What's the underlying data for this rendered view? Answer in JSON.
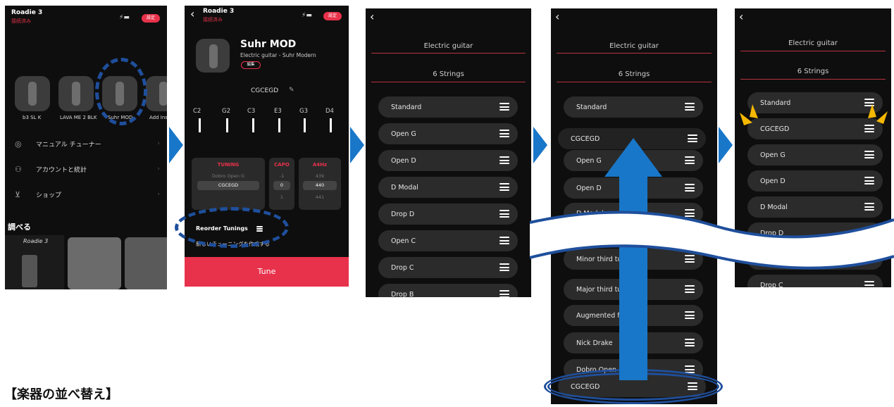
{
  "caption": "【楽器の並べ替え】",
  "screen1": {
    "app_title": "Roadie 3",
    "app_status": "接続済み",
    "pill": "設定",
    "instruments": [
      "b3 SL K",
      "LAVA ME 2 BLK",
      "Suhr MOD",
      "Add Ins"
    ],
    "menu": [
      "マニュアル チューナー",
      "アカウントと統計",
      "ショップ"
    ],
    "section": "調べる",
    "brand": "Roadie 3"
  },
  "screen2": {
    "app_title": "Roadie 3",
    "app_status": "接続済み",
    "pill": "設定",
    "name": "Suhr MOD",
    "subtitle": "Electric guitar - Suhr Modern",
    "edit_pill": "編集",
    "tuning_name": "CGCEGD",
    "notes": [
      "C2",
      "G2",
      "C3",
      "E3",
      "G3",
      "D4"
    ],
    "tuning_header": "TUNING",
    "capo_header": "CAPO",
    "hz_header": "A4Hz",
    "tuning_options": [
      "Dobro Open G",
      "CGCEGD"
    ],
    "capo_options": [
      "-1",
      "0",
      "1"
    ],
    "hz_options": [
      "439",
      "440",
      "441"
    ],
    "reorder": "Reorder Tunings",
    "create_new": "新しいチューニングを作成する",
    "tune_button": "Tune"
  },
  "screen3": {
    "header": "Electric guitar",
    "strings": "6 Strings",
    "items": [
      "Standard",
      "Open G",
      "Open D",
      "D Modal",
      "Drop D",
      "Open C",
      "Drop C",
      "Drop B"
    ]
  },
  "screen4": {
    "header": "Electric guitar",
    "strings": "6 Strings",
    "items": [
      "Standard",
      "CGCEGD",
      "Open G",
      "Open D",
      "D Modal",
      "Minor third tu",
      "Major third tu",
      "Augmented f",
      "Nick Drake",
      "Dobro Open",
      "CGCEGD"
    ]
  },
  "screen5": {
    "header": "Electric guitar",
    "strings": "6 Strings",
    "items": [
      "Standard",
      "CGCEGD",
      "Open G",
      "Open D",
      "D Modal",
      "Drop D",
      "Open C",
      "Drop C"
    ]
  },
  "colors": {
    "accent_red": "#e8324b",
    "arrow_blue": "#1877c9",
    "oval_blue": "#1f4f9c"
  }
}
